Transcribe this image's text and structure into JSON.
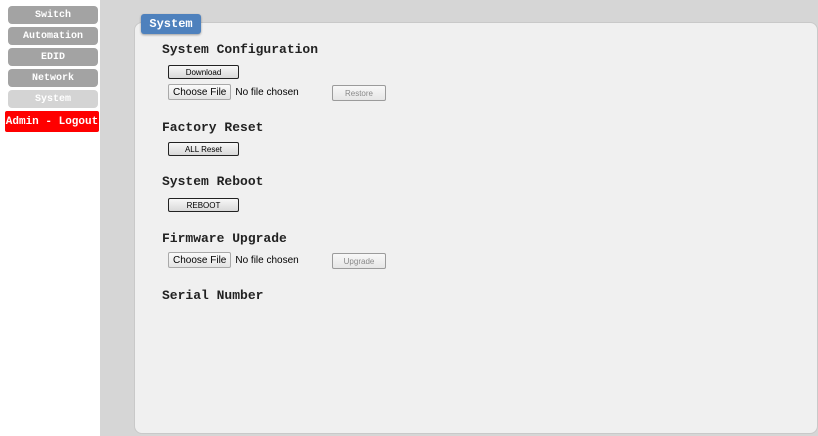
{
  "sidebar": {
    "items": [
      {
        "label": "Switch"
      },
      {
        "label": "Automation"
      },
      {
        "label": "EDID"
      },
      {
        "label": "Network"
      },
      {
        "label": "System"
      }
    ],
    "logout_label": "Admin - Logout"
  },
  "panel": {
    "tab_label": "System",
    "system_configuration": {
      "heading": "System Configuration",
      "download_label": "Download",
      "choose_file_label": "Choose File",
      "file_status": "No file chosen",
      "restore_label": "Restore"
    },
    "factory_reset": {
      "heading": "Factory Reset",
      "all_reset_label": "ALL Reset"
    },
    "system_reboot": {
      "heading": "System Reboot",
      "reboot_label": "REBOOT"
    },
    "firmware_upgrade": {
      "heading": "Firmware Upgrade",
      "choose_file_label": "Choose File",
      "file_status": "No file chosen",
      "upgrade_label": "Upgrade"
    },
    "serial_number": {
      "heading": "Serial Number"
    }
  },
  "colors": {
    "nav_inactive": "#a3a3a3",
    "nav_active": "#d4d4d4",
    "logout": "#ff0000",
    "tab": "#4e81bd",
    "panel_bg": "#f0f0f0",
    "content_bg": "#d6d6d6"
  }
}
